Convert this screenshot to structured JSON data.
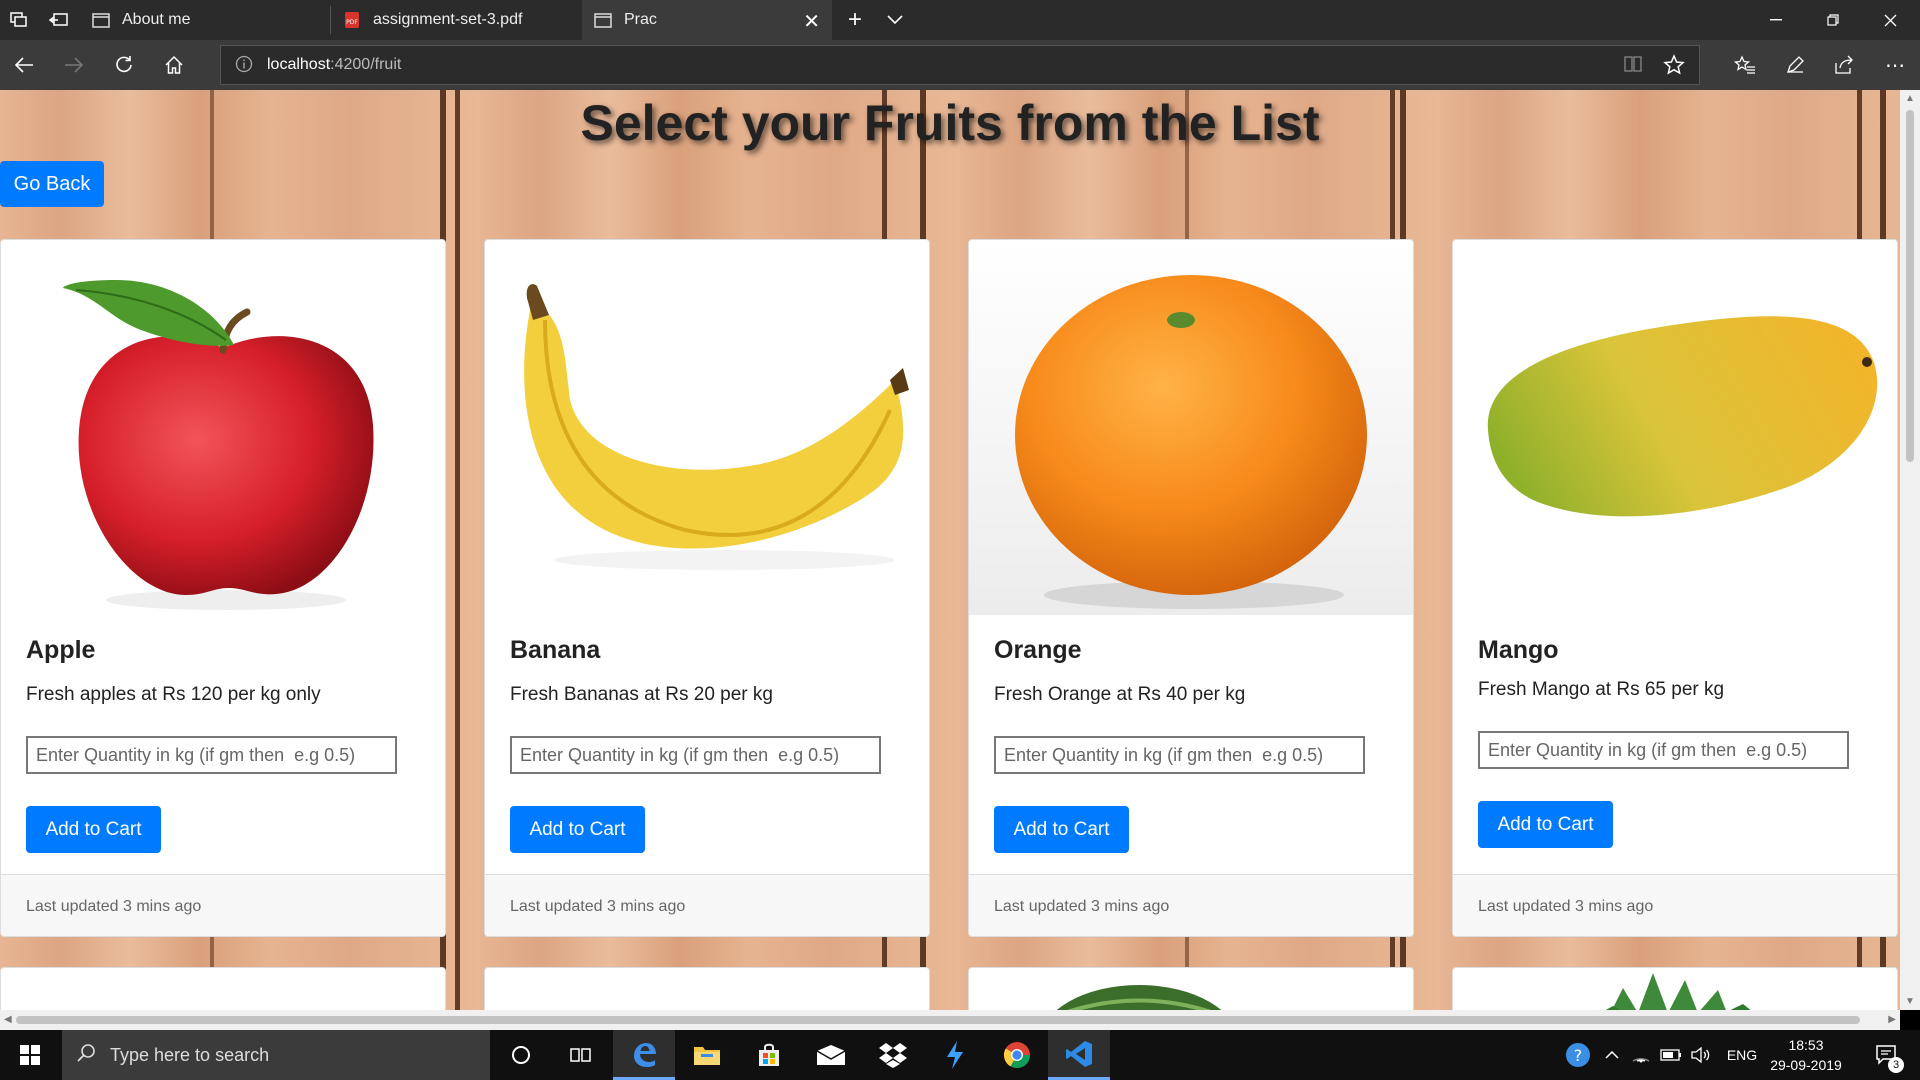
{
  "browser": {
    "tabs": [
      {
        "title": "About me",
        "active": false
      },
      {
        "title": "assignment-set-3.pdf",
        "active": false
      },
      {
        "title": "Prac",
        "active": true
      }
    ],
    "url_host": "localhost",
    "url_path": ":4200/fruit"
  },
  "page": {
    "title": "Select your Fruits from the List",
    "go_back_label": "Go Back",
    "colors": {
      "primary": "#007bff",
      "card_bg": "#ffffff",
      "footer_bg": "#f7f7f7"
    }
  },
  "products": [
    {
      "name": "Apple",
      "description": "Fresh apples at Rs 120 per kg only",
      "qty_placeholder": "Enter Quantity in kg (if gm then  e.g 0.5)",
      "button_label": "Add to Cart",
      "footer": "Last updated 3 mins ago"
    },
    {
      "name": "Banana",
      "description": "Fresh Bananas at Rs 20 per kg",
      "qty_placeholder": "Enter Quantity in kg (if gm then  e.g 0.5)",
      "button_label": "Add to Cart",
      "footer": "Last updated 3 mins ago"
    },
    {
      "name": "Orange",
      "description": "Fresh Orange at Rs 40 per kg",
      "qty_placeholder": "Enter Quantity in kg (if gm then  e.g 0.5)",
      "button_label": "Add to Cart",
      "footer": "Last updated 3 mins ago"
    },
    {
      "name": "Mango",
      "description": "Fresh Mango at Rs 65 per kg",
      "qty_placeholder": "Enter Quantity in kg (if gm then  e.g 0.5)",
      "button_label": "Add to Cart",
      "footer": "Last updated 3 mins ago"
    }
  ],
  "taskbar": {
    "search_placeholder": "Type here to search",
    "language": "ENG",
    "time": "18:53",
    "date": "29-09-2019",
    "notification_count": "3"
  }
}
